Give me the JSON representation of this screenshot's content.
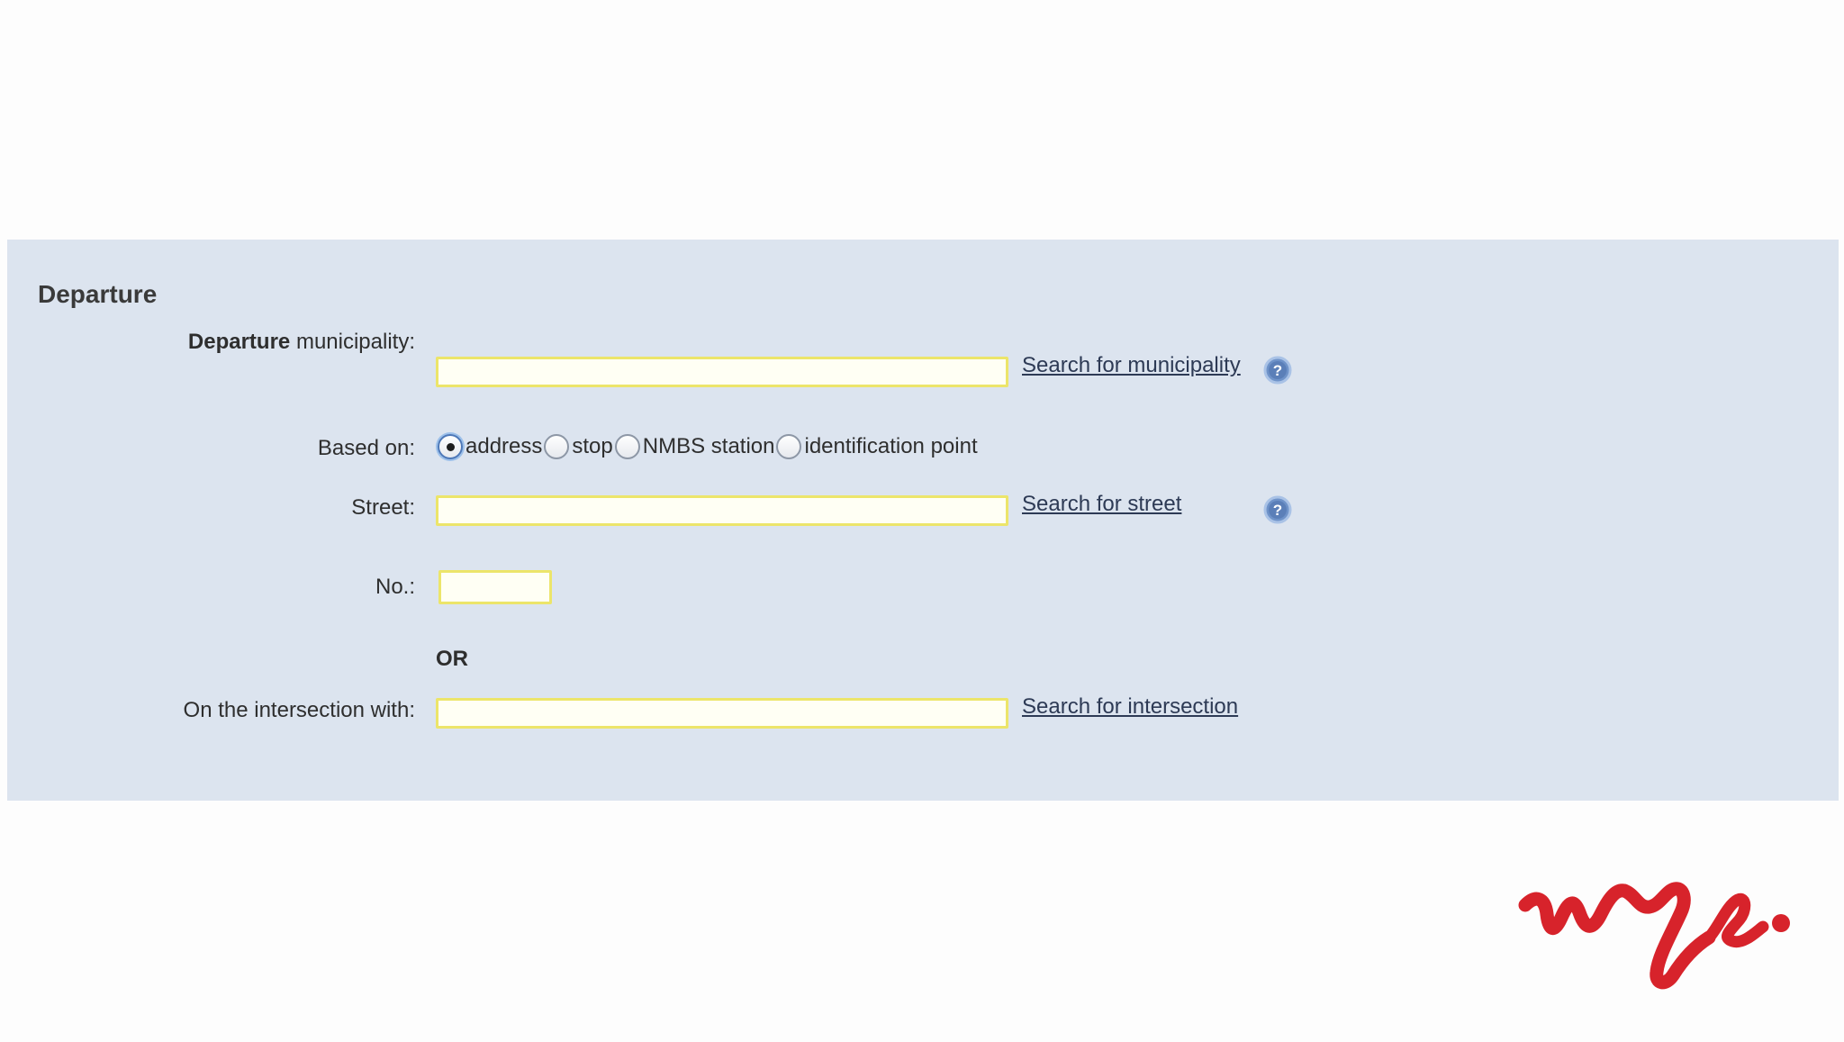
{
  "panel": {
    "title": "Departure"
  },
  "fields": {
    "municipality": {
      "label_bold": "Departure",
      "label_rest": " municipality:",
      "value": "",
      "search_link": "Search for municipality"
    },
    "based_on": {
      "label": "Based on:",
      "selected": "address",
      "options": [
        "address",
        "stop",
        "NMBS station",
        "identification point"
      ]
    },
    "street": {
      "label": "Street:",
      "value": "",
      "search_link": "Search for street"
    },
    "number": {
      "label": "No.:",
      "value": ""
    },
    "or_separator": "OR",
    "intersection": {
      "label": "On the intersection with:",
      "value": "",
      "search_link": "Search for intersection"
    }
  },
  "icons": {
    "help": "help-icon",
    "logo": "brand-logo-icon"
  },
  "colors": {
    "panel_background": "#dce4ef",
    "input_border": "#ece56a",
    "link": "#2d3a55",
    "logo": "#d7232b"
  }
}
